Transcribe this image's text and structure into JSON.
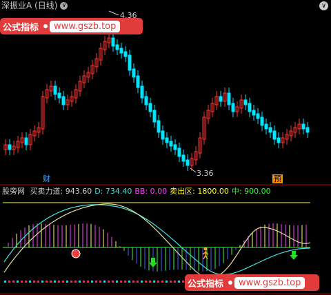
{
  "window": {
    "title": "深振业A (日线)",
    "title_button": "∨",
    "corner_button": "∨"
  },
  "watermark": {
    "label": "公式指标",
    "url": "www.gszb.top"
  },
  "price": {
    "high_label": "4.36",
    "low_label": "3.36",
    "badge_left": "财",
    "badge_right": "预"
  },
  "indicator": {
    "name": "股旁网",
    "fields": [
      {
        "label": "买卖力道:",
        "value": "943.60",
        "color": "#d0d0d0"
      },
      {
        "label": "D:",
        "value": "734.40",
        "color": "#44e0e0"
      },
      {
        "label": "BB:",
        "value": "0.00",
        "color": "#ff44ff"
      },
      {
        "label": "卖出区:",
        "value": "1800.00",
        "color": "#ffff33"
      },
      {
        "label": "中:",
        "value": "900.00",
        "color": "#33ff33"
      }
    ]
  },
  "colors": {
    "up": "#ff3232",
    "down": "#00e5ff",
    "divider": "#b00000",
    "sell_line": "#ffff33",
    "mid_line": "#33ff33",
    "d_line": "#44e0e0",
    "k_line": "#e0e0a0",
    "watermark_bg": "#e23b3b"
  }
}
